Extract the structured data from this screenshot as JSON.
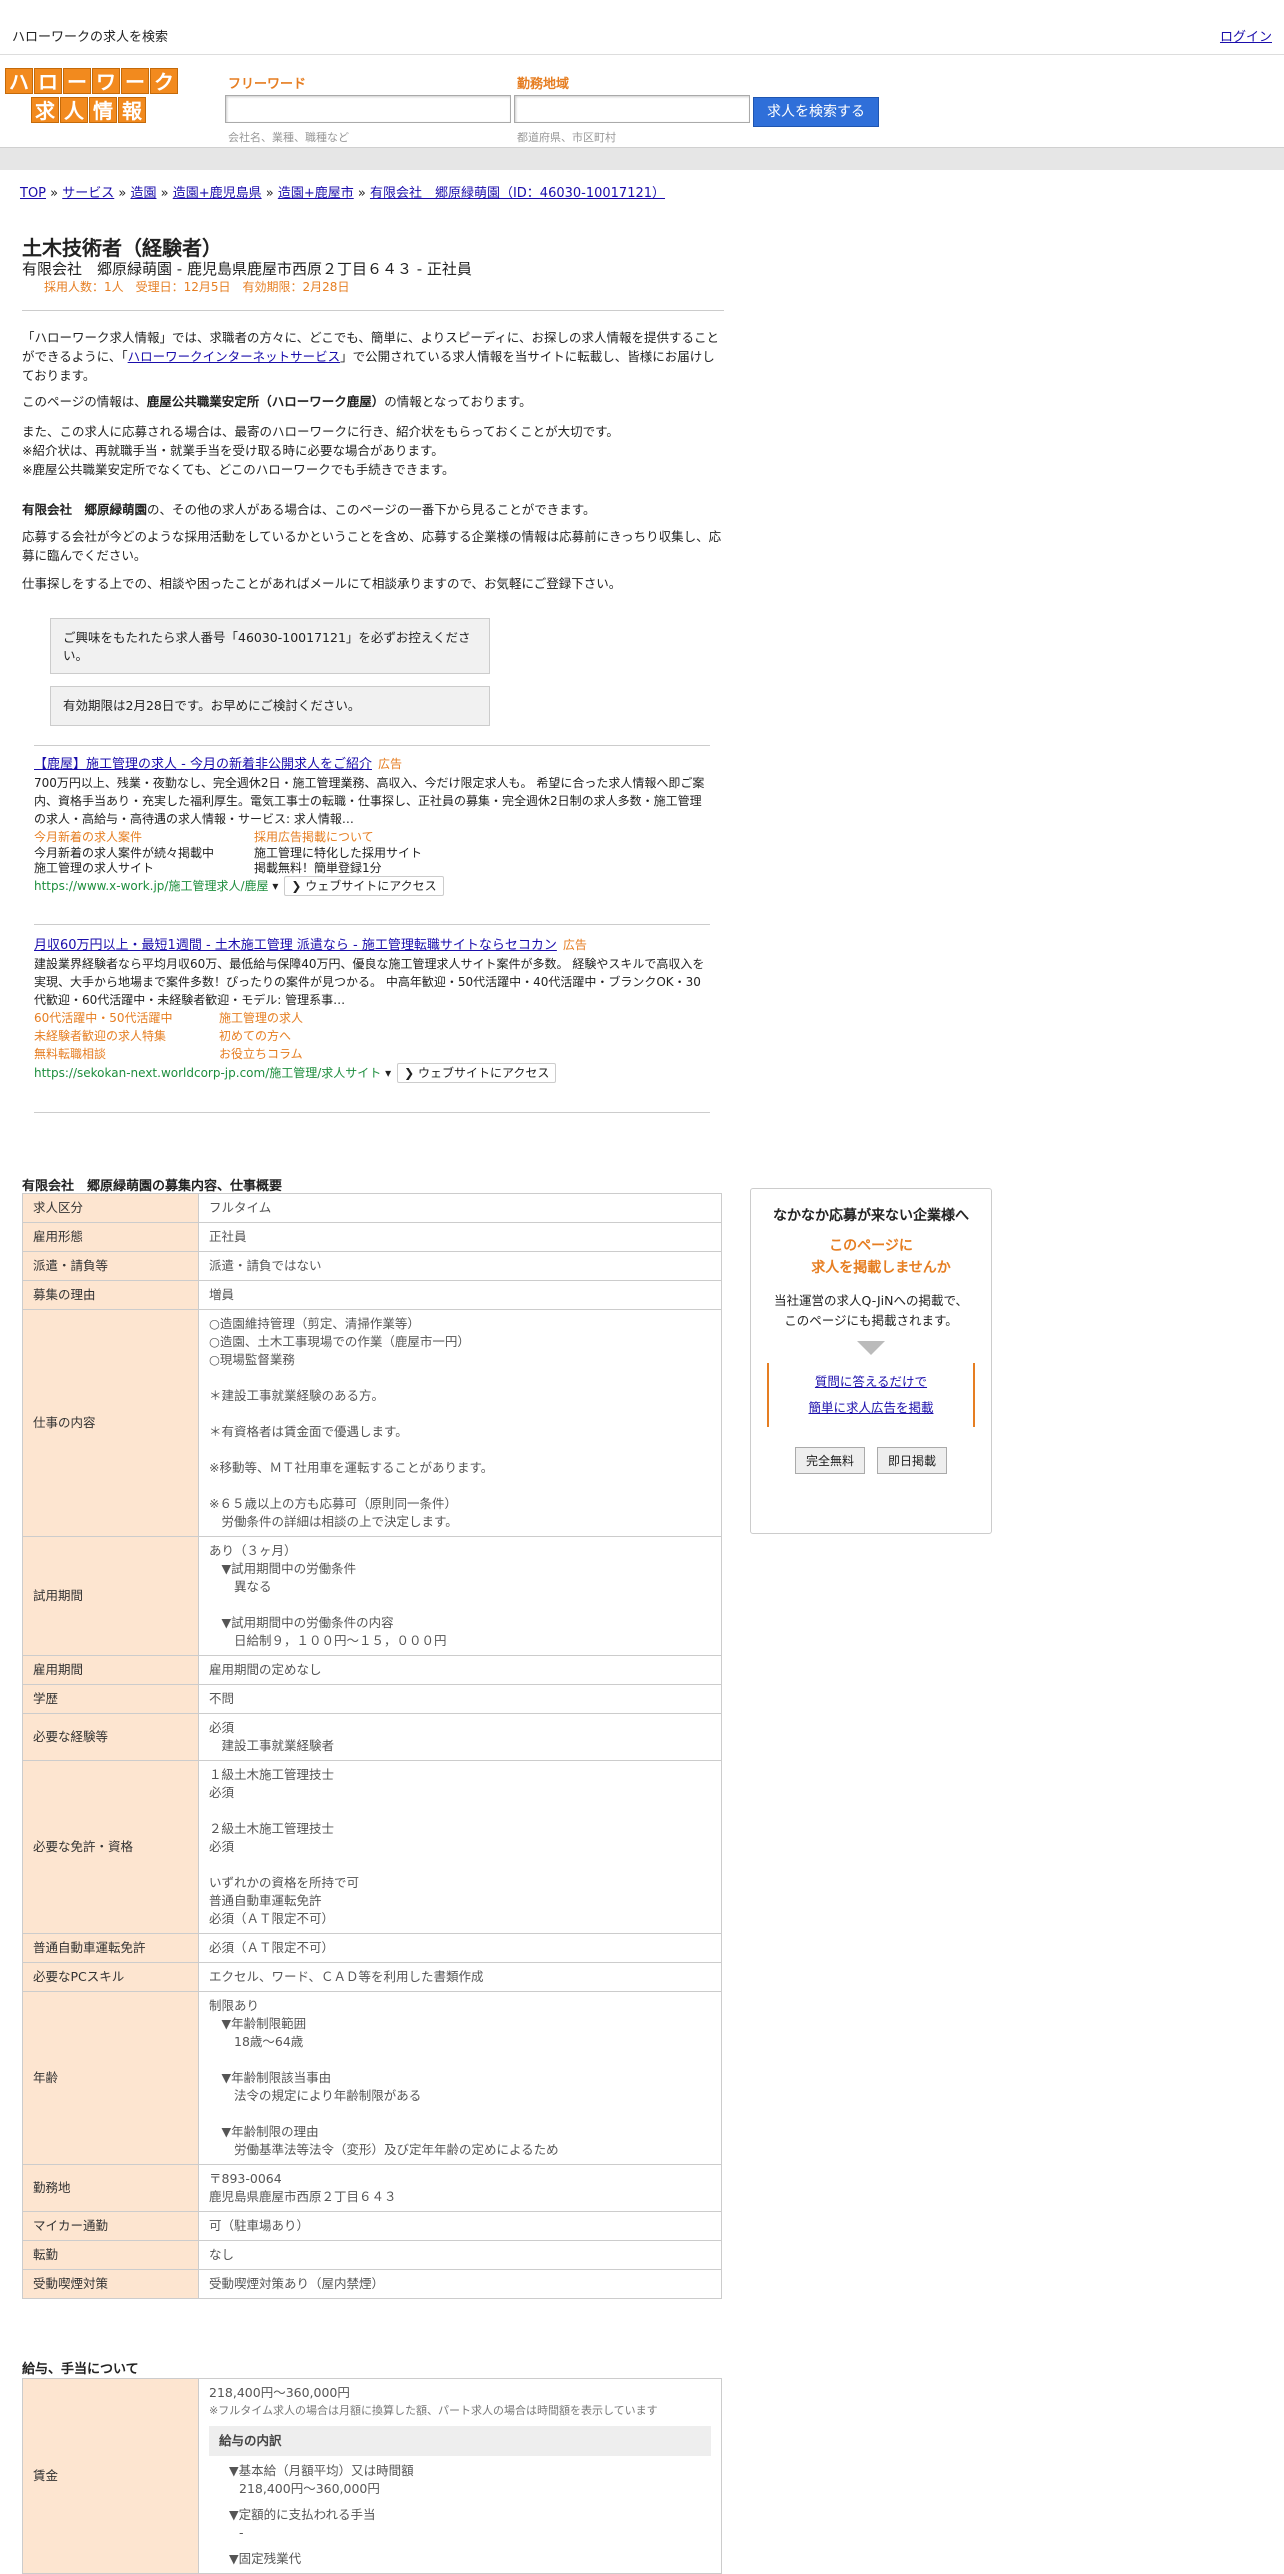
{
  "topbar": {
    "title": "ハローワークの求人を検索",
    "login": "ログイン"
  },
  "logo": {
    "row1": [
      "ハ",
      "ロ",
      "ー",
      "ワ",
      "ー",
      "ク"
    ],
    "row2": [
      "求",
      "人",
      "情",
      "報"
    ],
    "color": "#f28a1e"
  },
  "search": {
    "keyword_label": "フリーワード",
    "keyword_hint": "会社名、業種、職種など",
    "area_label": "勤務地域",
    "area_hint": "都道府県、市区町村",
    "button": "求人を検索する"
  },
  "breadcrumb": [
    "TOP",
    "サービス",
    "造園",
    "造園+鹿児島県",
    "造園+鹿屋市",
    "有限会社　郷原緑萌園（ID：46030-10017121）"
  ],
  "job": {
    "title": "土木技術者（経験者）",
    "subtitle": "有限会社　郷原緑萌園 - 鹿児島県鹿屋市西原２丁目６４３ - 正社員",
    "meta": "採用人数：1人　受理日：12月5日　有効期限：2月28日"
  },
  "intro": {
    "p1a": "「ハローワーク求人情報」では、求職者の方々に、どこでも、簡単に、よりスピーディに、お探しの求人情報を提供することができるように、「",
    "p1link": "ハローワークインターネットサービス",
    "p1b": "」で公開されている求人情報を当サイトに転載し、皆様にお届けしております。",
    "p2a": "このページの情報は、",
    "p2b": "鹿屋公共職業安定所（ハローワーク鹿屋）",
    "p2c": "の情報となっております。",
    "p3": "また、この求人に応募される場合は、最寄のハローワークに行き、紹介状をもらっておくことが大切です。\n※紹介状は、再就職手当・就業手当を受け取る時に必要な場合があります。\n※鹿屋公共職業安定所でなくても、どこのハローワークでも手続きできます。",
    "p4a": "有限会社　郷原緑萌園",
    "p4b": "の、その他の求人がある場合は、このページの一番下から見ることができます。",
    "p5": "応募する会社が今どのような採用活動をしているかということを含め、応募する企業様の情報は応募前にきっちり収集し、応募に臨んでください。",
    "p6": "仕事探しをする上での、相談や困ったことがあればメールにて相談承りますので、お気軽にご登録下さい。",
    "note1": "ご興味をもたれたら求人番号「46030-10017121」を必ずお控えください。",
    "note2": "有効期限は2月28日です。お早めにご検討ください。"
  },
  "ads": [
    {
      "title": "【鹿屋】施工管理の求人 - 今月の新着非公開求人をご紹介",
      "tag": "広告",
      "desc": "700万円以上、残業・夜勤なし、完全週休2日・施工管理業務、高収入、今だけ限定求人も。 希望に合った求人情報へ即ご案内、資格手当あり・充実した福利厚生。電気工事士の転職・仕事探し、正社員の募集・完全週休2日制の求人多数・施工管理の求人・高給与・高待遇の求人情報・サービス: 求人情報…",
      "links": [
        [
          "今月新着の求人案件",
          "採用広告掲載について"
        ]
      ],
      "extra": [
        [
          "今月新着の求人案件が続々掲載中",
          "施工管理に特化した採用サイト"
        ],
        [
          "施工管理の求人サイト",
          "掲載無料！簡単登録1分"
        ]
      ],
      "url": "https://www.x-work.jp/施工管理求人/鹿屋",
      "visit": "❯ ウェブサイトにアクセス"
    },
    {
      "title": "月収60万円以上・最短1週間 - 土木施工管理 派遣なら - 施工管理転職サイトならセコカン",
      "tag": "広告",
      "desc": "建設業界経験者なら平均月収60万、最低給与保障40万円、優良な施工管理求人サイト案件が多数。 経験やスキルで高収入を実現、大手から地場まで案件多数！ぴったりの案件が見つかる。 中高年歓迎・50代活躍中・40代活躍中・ブランクOK・30代歓迎・60代活躍中・未経験者歓迎・モデル: 管理系事…",
      "links": [
        [
          "60代活躍中・50代活躍中",
          "施工管理の求人"
        ],
        [
          "未経験者歓迎の求人特集",
          "初めての方へ"
        ],
        [
          "無料転職相談",
          "お役立ちコラム"
        ]
      ],
      "url": "https://sekokan-next.worldcorp-jp.com/施工管理/求人サイト",
      "visit": "❯ ウェブサイトにアクセス"
    }
  ],
  "section1": "有限会社　郷原緑萌園の募集内容、仕事概要",
  "rows": [
    {
      "k": "求人区分",
      "v": "フルタイム"
    },
    {
      "k": "雇用形態",
      "v": "正社員"
    },
    {
      "k": "派遣・請負等",
      "v": "派遣・請負ではない"
    },
    {
      "k": "募集の理由",
      "v": "増員"
    },
    {
      "k": "仕事の内容",
      "v": "○造園維持管理（剪定、清掃作業等）\n○造園、土木工事現場での作業（鹿屋市一円）\n○現場監督業務\n\n＊建設工事就業経験のある方。\n\n＊有資格者は賃金面で優遇します。\n\n※移動等、ＭＴ社用車を運転することがあります。\n\n※６５歳以上の方も応募可（原則同一条件）\n　労働条件の詳細は相談の上で決定します。"
    },
    {
      "k": "試用期間",
      "v": "あり（３ヶ月）\n　▼試用期間中の労働条件\n　　異なる\n\n　▼試用期間中の労働条件の内容\n　　日給制９，１００円～１５，０００円"
    },
    {
      "k": "雇用期間",
      "v": "雇用期間の定めなし"
    },
    {
      "k": "学歴",
      "v": "不問"
    },
    {
      "k": "必要な経験等",
      "v": "必須\n　建設工事就業経験者"
    },
    {
      "k": "必要な免許・資格",
      "v": "１級土木施工管理技士\n必須\n\n２級土木施工管理技士\n必須\n\nいずれかの資格を所持で可\n普通自動車運転免許\n必須（ＡＴ限定不可）\n"
    },
    {
      "k": "普通自動車運転免許",
      "v": "必須（ＡＴ限定不可）"
    },
    {
      "k": "必要なPCスキル",
      "v": "エクセル、ワード、ＣＡＤ等を利用した書類作成"
    },
    {
      "k": "年齢",
      "v": "制限あり\n　▼年齢制限範囲\n　　18歳～64歳\n\n　▼年齢制限該当事由\n　　法令の規定により年齢制限がある\n\n　▼年齢制限の理由\n　　労働基準法等法令（変形）及び定年年齢の定めによるため"
    },
    {
      "k": "勤務地",
      "v": "〒893-0064\n鹿児島県鹿屋市西原２丁目６４３"
    },
    {
      "k": "マイカー通勤",
      "v": "可（駐車場あり）"
    },
    {
      "k": "転勤",
      "v": "なし"
    },
    {
      "k": "受動喫煙対策",
      "v": "受動喫煙対策あり（屋内禁煙）"
    }
  ],
  "section2": "給与、手当について",
  "salary": {
    "k": "賃金",
    "range": "218,400円〜360,000円",
    "note": "※フルタイム求人の場合は月額に換算した額、パート求人の場合は時間額を表示しています",
    "breakdown_title": "給与の内訳",
    "b1": "▼基本給（月額平均）又は時間額",
    "b1v": "218,400円〜360,000円",
    "b2": "▼定額的に支払われる手当",
    "b2v": "-",
    "b3": "▼固定残業代"
  },
  "side": {
    "heading": "なかなか応募が来ない企業様へ",
    "orange1": "このページに",
    "orange2": "求人を掲載しませんか",
    "desc1": "当社運営の求人Q-JiNへの掲載で、",
    "desc2": "このページにも掲載されます。",
    "link1": "質問に答えるだけで",
    "link2": "簡単に求人広告を掲載",
    "btn1": "完全無料",
    "btn2": "即日掲載"
  }
}
